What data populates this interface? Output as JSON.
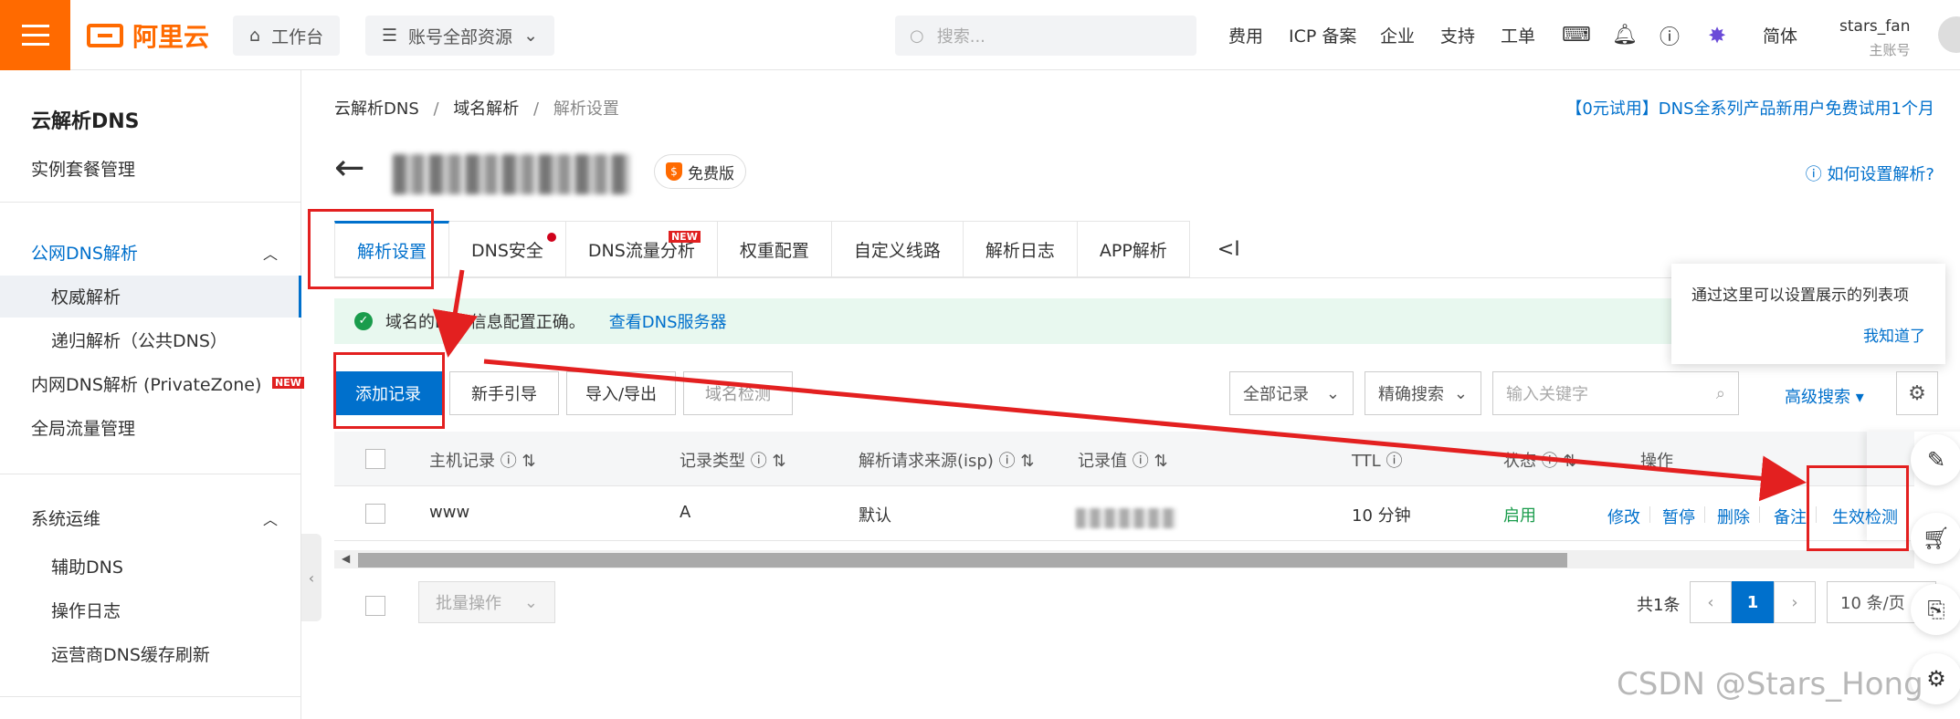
{
  "topbar": {
    "logo_text": "阿里云",
    "workbench": "工作台",
    "resources": "账号全部资源",
    "search_placeholder": "搜索...",
    "nav": [
      "费用",
      "ICP 备案",
      "企业",
      "支持",
      "工单"
    ],
    "lang": "简体",
    "username": "stars_fan",
    "account_type": "主账号"
  },
  "sidebar": {
    "title": "云解析DNS",
    "instance": "实例套餐管理",
    "public_dns": "公网DNS解析",
    "authoritative": "权威解析",
    "recursive": "递归解析（公共DNS）",
    "private_zone": "内网DNS解析 (PrivateZone)",
    "private_zone_badge": "NEW",
    "global_traffic": "全局流量管理",
    "ops": "系统运维",
    "aux_dns": "辅助DNS",
    "oplog": "操作日志",
    "cache_refresh": "运营商DNS缓存刷新"
  },
  "breadcrumb": {
    "item1": "云解析DNS",
    "item2": "域名解析",
    "item3": "解析设置",
    "sep": "/"
  },
  "promo": "【0元试用】DNS全系列产品新用户免费试用1个月",
  "free_badge": "免费版",
  "howto": "如何设置解析?",
  "tabs": {
    "t1": "解析设置",
    "t2": "DNS安全",
    "t3": "DNS流量分析",
    "t3_badge": "NEW",
    "t4": "权重配置",
    "t5": "自定义线路",
    "t6": "解析日志",
    "t7": "APP解析",
    "more": "<I"
  },
  "notice": {
    "text": "域名的DNS信息配置正确。",
    "link": "查看DNS服务器"
  },
  "tooltip": {
    "text": "通过这里可以设置展示的列表项",
    "got_it": "我知道了"
  },
  "toolbar": {
    "add": "添加记录",
    "guide": "新手引导",
    "import_export": "导入/导出",
    "check": "域名检测",
    "all_records": "全部记录",
    "exact_search": "精确搜索",
    "keyword_placeholder": "输入关键字",
    "advanced": "高级搜索"
  },
  "table": {
    "headers": {
      "host": "主机记录",
      "type": "记录类型",
      "isp": "解析请求来源(isp)",
      "value": "记录值",
      "ttl": "TTL",
      "status": "状态",
      "ops": "操作"
    },
    "row": {
      "host": "www",
      "type": "A",
      "isp": "默认",
      "ttl": "10 分钟",
      "status": "启用"
    },
    "row_ops": {
      "edit": "修改",
      "pause": "暂停",
      "delete": "删除",
      "remark": "备注",
      "verify": "生效检测"
    }
  },
  "footer": {
    "batch": "批量操作",
    "total": "共1条",
    "page": "1",
    "page_size": "10 条/页"
  },
  "watermark": "CSDN @Stars_Hong",
  "colors": {
    "brand": "#ff6a00",
    "primary": "#0070cc",
    "success": "#1a9c4c",
    "annotation": "#e32020"
  }
}
